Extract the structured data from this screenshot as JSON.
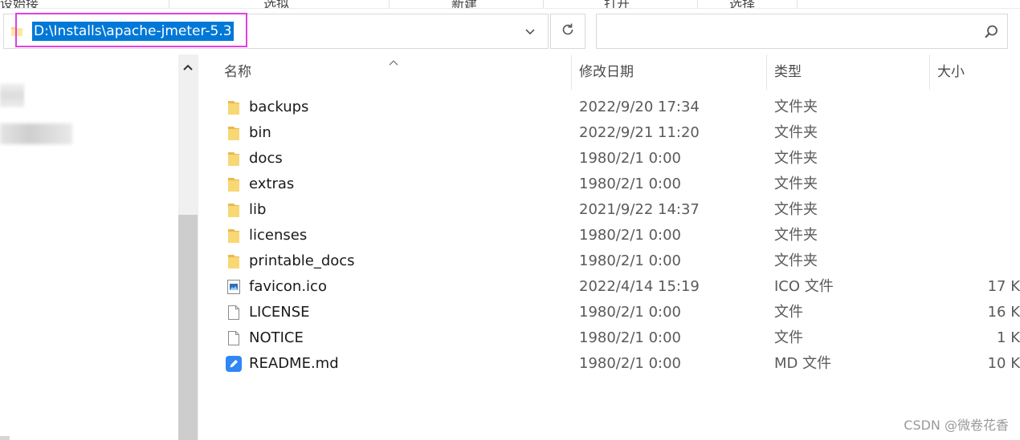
{
  "ribbon": {
    "segments": [
      "设始接",
      "选拟",
      "新建",
      "打开",
      "选择"
    ]
  },
  "address": {
    "path": "D:\\Installs\\apache-jmeter-5.3"
  },
  "search": {
    "placeholder": ""
  },
  "columns": {
    "name": "名称",
    "date": "修改日期",
    "type": "类型",
    "size": "大小"
  },
  "files": [
    {
      "name": "backups",
      "date": "2022/9/20 17:34",
      "type": "文件夹",
      "size": "",
      "icon": "folder-icon"
    },
    {
      "name": "bin",
      "date": "2022/9/21 11:20",
      "type": "文件夹",
      "size": "",
      "icon": "folder-icon"
    },
    {
      "name": "docs",
      "date": "1980/2/1 0:00",
      "type": "文件夹",
      "size": "",
      "icon": "folder-icon"
    },
    {
      "name": "extras",
      "date": "1980/2/1 0:00",
      "type": "文件夹",
      "size": "",
      "icon": "folder-icon"
    },
    {
      "name": "lib",
      "date": "2021/9/22 14:37",
      "type": "文件夹",
      "size": "",
      "icon": "folder-icon"
    },
    {
      "name": "licenses",
      "date": "1980/2/1 0:00",
      "type": "文件夹",
      "size": "",
      "icon": "folder-icon"
    },
    {
      "name": "printable_docs",
      "date": "1980/2/1 0:00",
      "type": "文件夹",
      "size": "",
      "icon": "folder-icon"
    },
    {
      "name": "favicon.ico",
      "date": "2022/4/14 15:19",
      "type": "ICO 文件",
      "size": "17 K",
      "icon": "image-file-icon"
    },
    {
      "name": "LICENSE",
      "date": "1980/2/1 0:00",
      "type": "文件",
      "size": "16 K",
      "icon": "blank-file-icon"
    },
    {
      "name": "NOTICE",
      "date": "1980/2/1 0:00",
      "type": "文件",
      "size": "1 K",
      "icon": "blank-file-icon"
    },
    {
      "name": "README.md",
      "date": "1980/2/1 0:00",
      "type": "MD 文件",
      "size": "10 K",
      "icon": "markdown-file-icon"
    }
  ],
  "watermark": "CSDN @微卷花香",
  "colors": {
    "selection": "#0078d7",
    "highlight_border": "#e040e0",
    "folder": "#f8d775"
  }
}
